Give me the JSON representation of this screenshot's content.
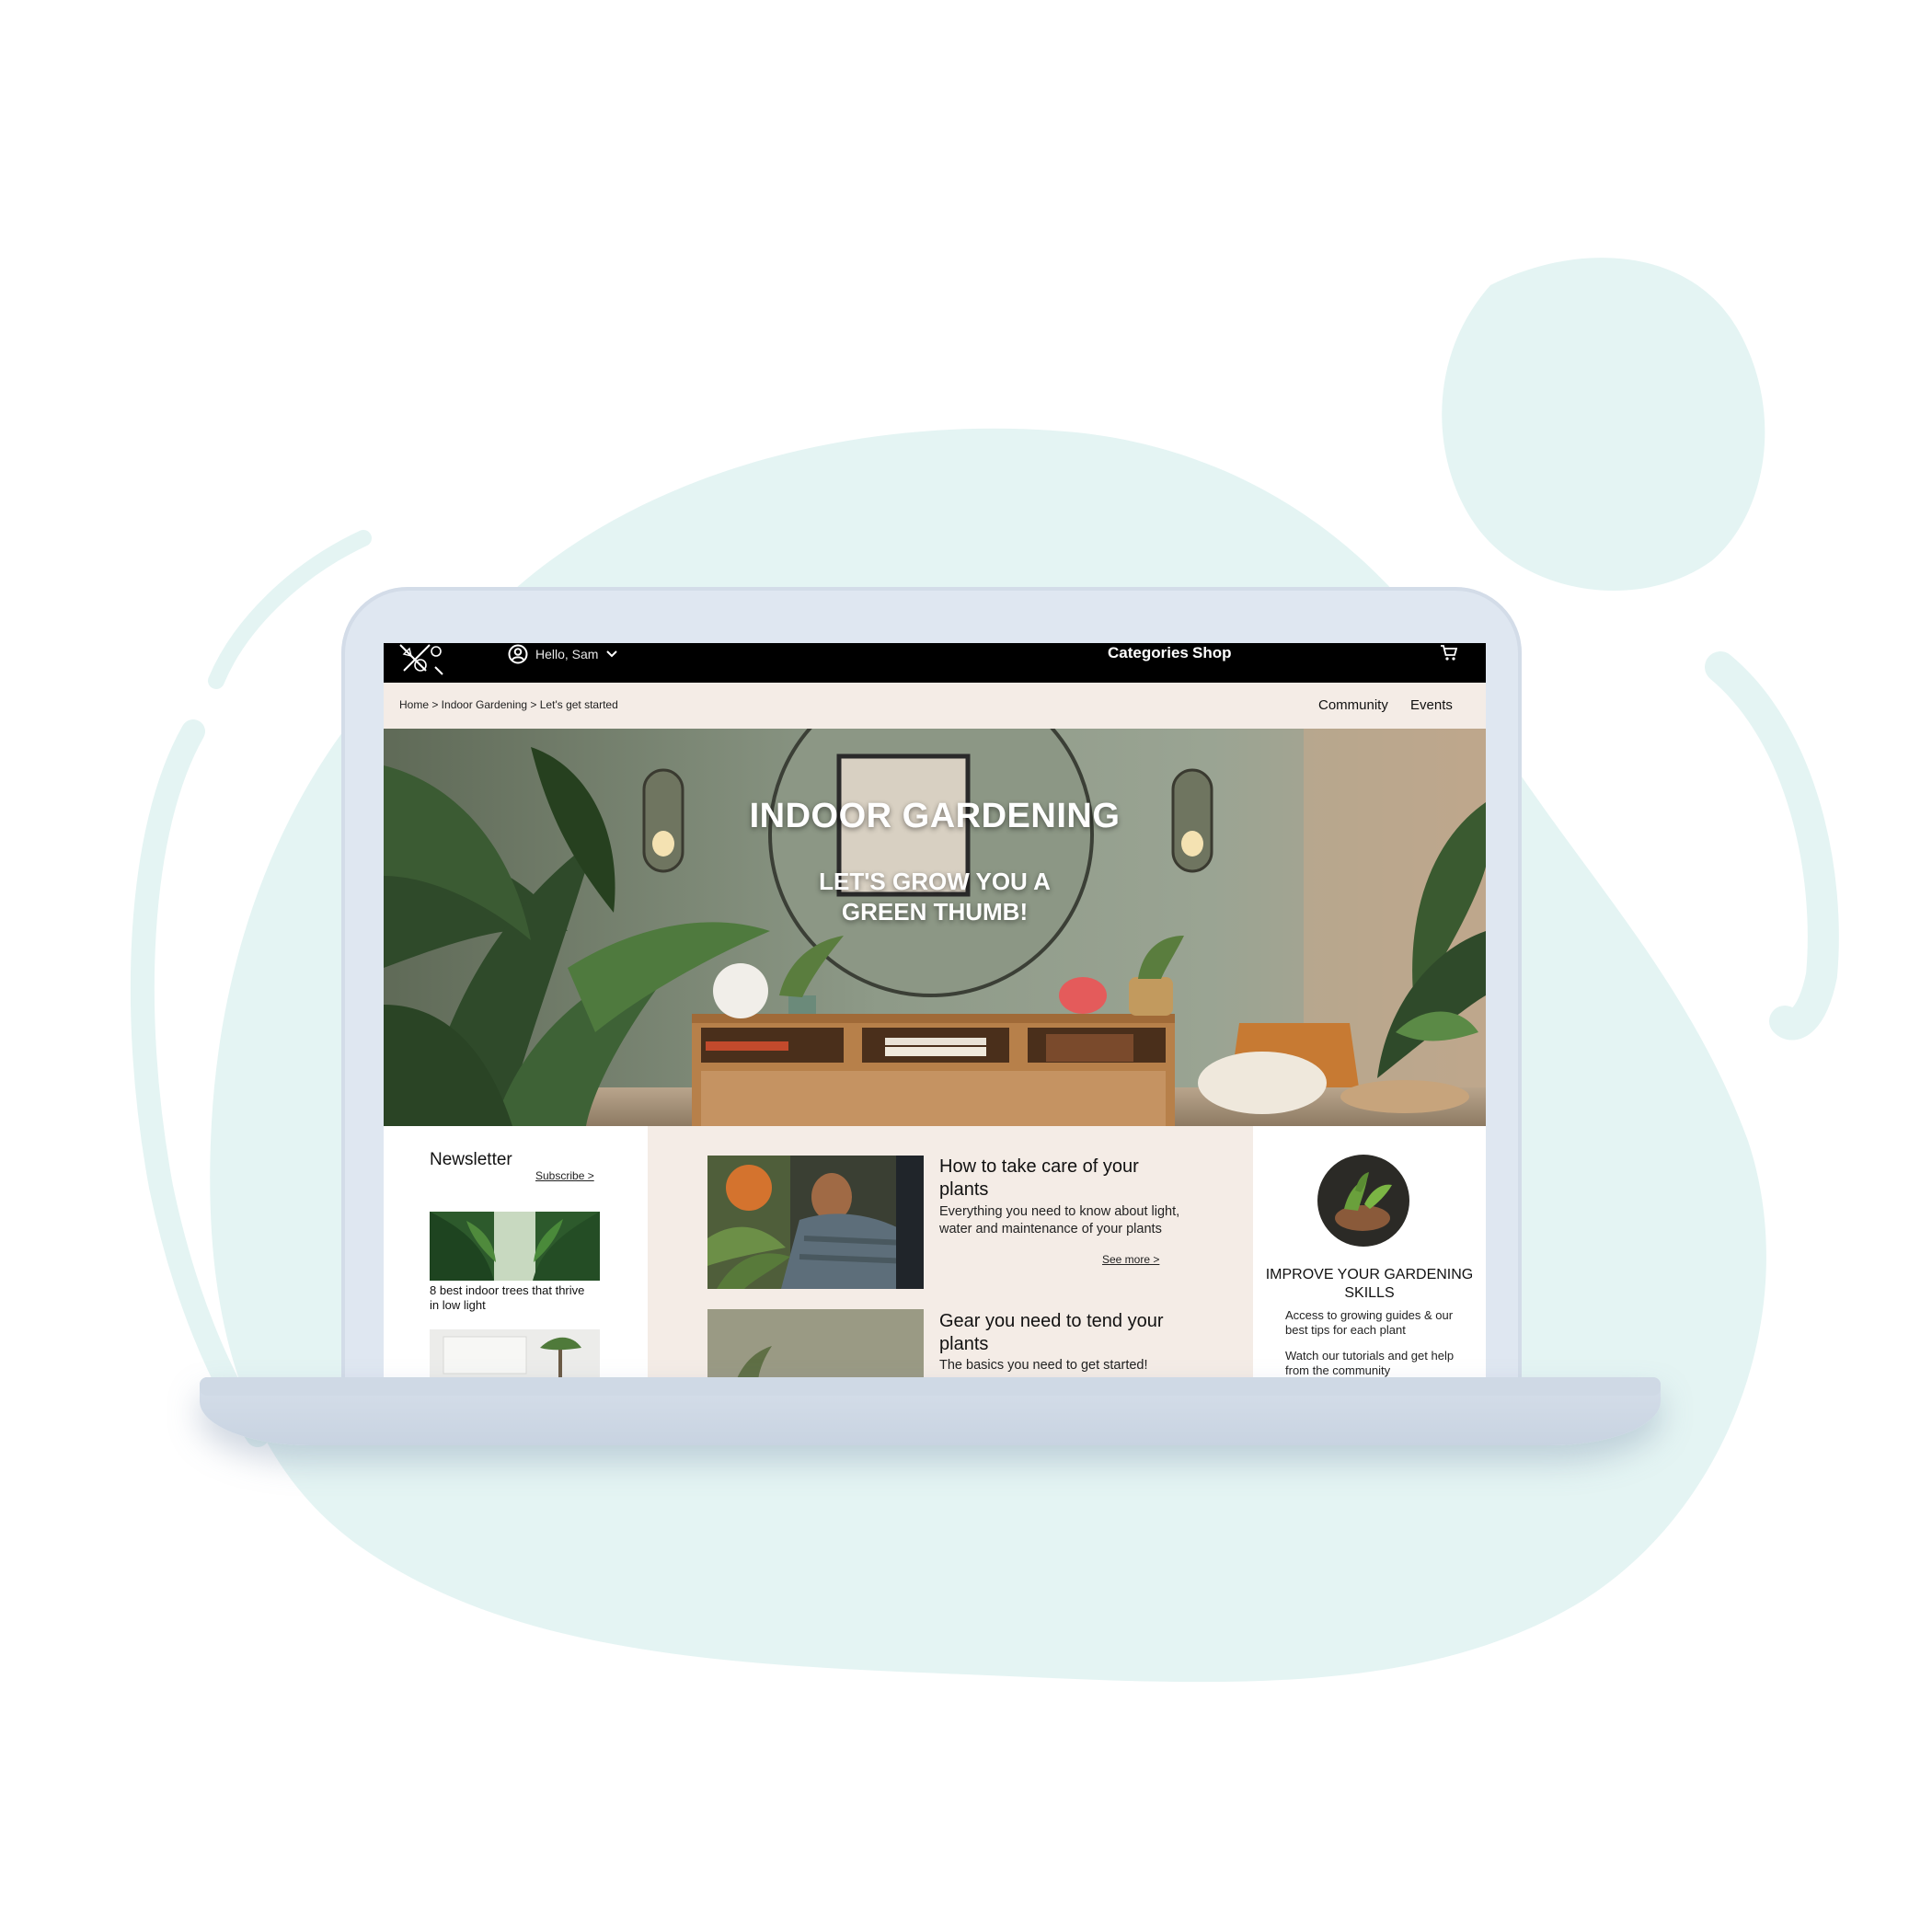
{
  "nav": {
    "user_greeting": "Hello, Sam",
    "links": [
      "Categories",
      "Shop"
    ]
  },
  "breadcrumb": {
    "path": "Home > Indoor Gardening > Let's get started",
    "links": [
      "Community",
      "Events"
    ]
  },
  "hero": {
    "title": "INDOOR GARDENING",
    "subtitle": "LET'S GROW YOU A GREEN THUMB!"
  },
  "newsletter": {
    "title": "Newsletter",
    "subscribe": "Subscribe >",
    "items": [
      {
        "caption": "8 best indoor trees that thrive in low light"
      }
    ]
  },
  "articles": [
    {
      "title": "How to take care of your plants",
      "description": "Everything you need to know about light, water and maintenance of your plants",
      "see_more": "See more >"
    },
    {
      "title": "Gear you need to tend your plants",
      "description": "The basics you need to get started!"
    }
  ],
  "skills": {
    "title": "IMPROVE YOUR GARDENING SKILLS",
    "points": [
      "Access to growing guides & our best tips for each plant",
      "Watch our tutorials and get help from the community"
    ]
  },
  "colors": {
    "blob": "#e4f4f3",
    "laptop": "#dfe7f1",
    "nav_bg": "#000000",
    "cream": "#f4ece6"
  },
  "icons": [
    "garden-tools-logo-icon",
    "user-circle-icon",
    "chevron-down-icon",
    "cart-icon"
  ]
}
